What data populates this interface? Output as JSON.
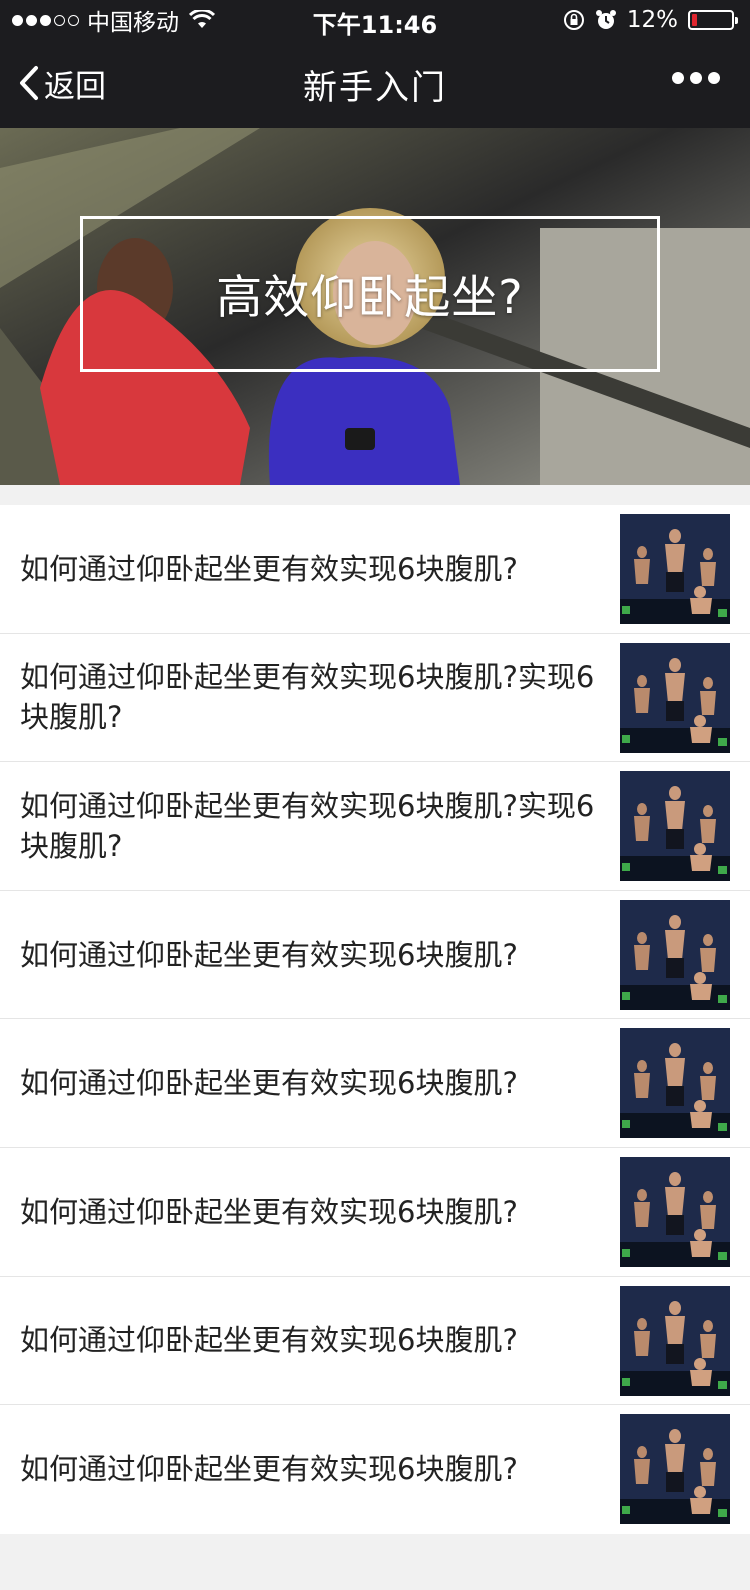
{
  "status_bar": {
    "carrier": "中国移动",
    "time": "下午11:46",
    "battery_text": "12%",
    "battery_level": 0.12,
    "colors": {
      "battery_low": "#e0262f"
    }
  },
  "nav": {
    "back_label": "返回",
    "title": "新手入门"
  },
  "banner": {
    "title": "高效仰卧起坐?"
  },
  "articles": [
    {
      "title": "如何通过仰卧起坐更有效实现6块腹肌?"
    },
    {
      "title": "如何通过仰卧起坐更有效实现6块腹肌?实现6块腹肌?"
    },
    {
      "title": "如何通过仰卧起坐更有效实现6块腹肌?实现6块腹肌?"
    },
    {
      "title": "如何通过仰卧起坐更有效实现6块腹肌?"
    },
    {
      "title": "如何通过仰卧起坐更有效实现6块腹肌?"
    },
    {
      "title": "如何通过仰卧起坐更有效实现6块腹肌?"
    },
    {
      "title": "如何通过仰卧起坐更有效实现6块腹肌?"
    },
    {
      "title": "如何通过仰卧起坐更有效实现6块腹肌?"
    }
  ],
  "icons": [
    "chevron-left-icon",
    "more-icon",
    "wifi-icon",
    "lock-rotation-icon",
    "alarm-icon",
    "battery-icon"
  ]
}
